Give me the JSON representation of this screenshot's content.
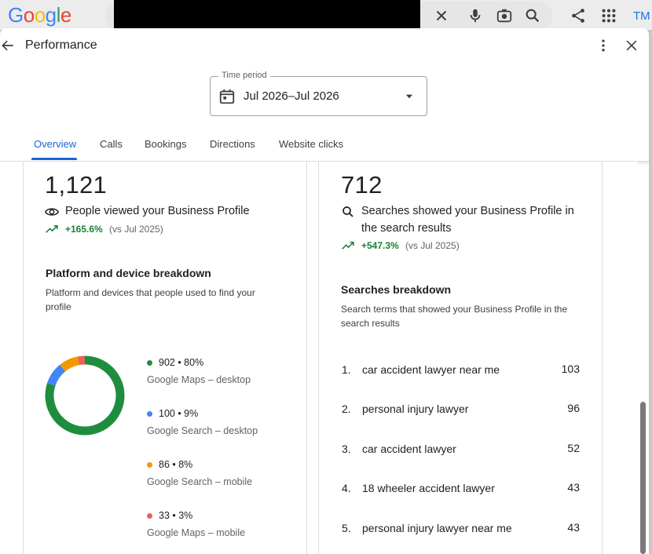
{
  "header": {
    "logo": "Google",
    "account_initials": "TM"
  },
  "panel": {
    "title": "Performance"
  },
  "time_period": {
    "label": "Time period",
    "value": "Jul 2026–Jul 2026"
  },
  "tabs": [
    {
      "label": "Overview",
      "active": true
    },
    {
      "label": "Calls"
    },
    {
      "label": "Bookings"
    },
    {
      "label": "Directions"
    },
    {
      "label": "Website clicks"
    }
  ],
  "views": {
    "count": "1,121",
    "label": "People viewed your Business Profile",
    "change": "+165.6%",
    "compare": "(vs Jul 2025)"
  },
  "searches": {
    "count": "712",
    "label_line1": "Searches showed your Business Profile in",
    "label_line2": "the search results",
    "change": "+547.3%",
    "compare": "(vs Jul 2025)"
  },
  "platform": {
    "title": "Platform and device breakdown",
    "desc_line1": "Platform and devices that people used to find your",
    "desc_line2": "profile",
    "items": [
      {
        "value": "902 • 80%",
        "label": "Google Maps – desktop",
        "pct": 80,
        "color": "#1e8e3e"
      },
      {
        "value": "100 • 9%",
        "label": "Google Search – desktop",
        "pct": 9,
        "color": "#4285f4"
      },
      {
        "value": "86 • 8%",
        "label": "Google Search – mobile",
        "pct": 8,
        "color": "#f29900"
      },
      {
        "value": "33 • 3%",
        "label": "Google Maps – mobile",
        "pct": 3,
        "color": "#e8615a"
      }
    ]
  },
  "search_breakdown": {
    "title": "Searches breakdown",
    "desc_line1": "Search terms that showed your Business Profile in the",
    "desc_line2": "search results",
    "items": [
      {
        "rank": "1.",
        "term": "car accident lawyer near me",
        "count": "103"
      },
      {
        "rank": "2.",
        "term": "personal injury lawyer",
        "count": "96"
      },
      {
        "rank": "3.",
        "term": "car accident lawyer",
        "count": "52"
      },
      {
        "rank": "4.",
        "term": "18 wheeler accident lawyer",
        "count": "43"
      },
      {
        "rank": "5.",
        "term": "personal injury lawyer near me",
        "count": "43"
      }
    ]
  }
}
